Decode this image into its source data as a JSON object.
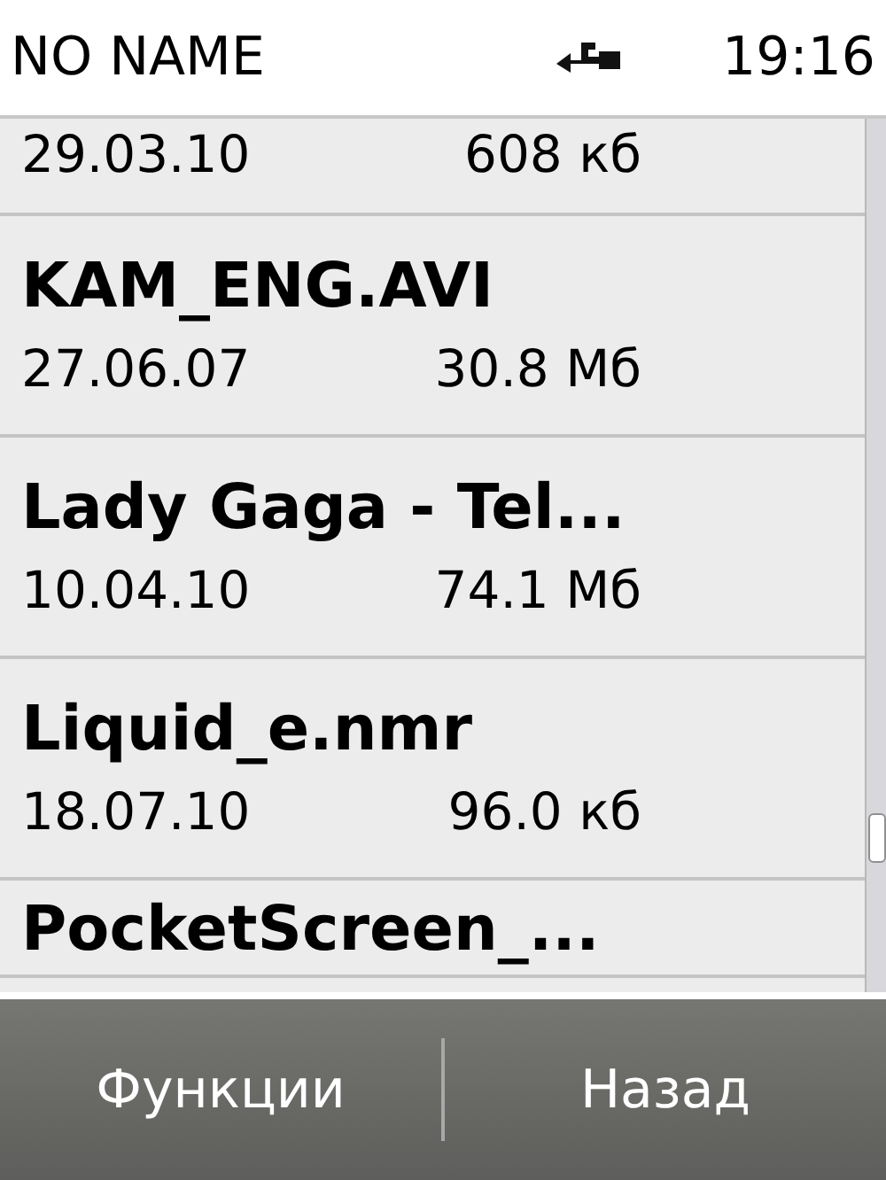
{
  "status_bar": {
    "title": "NO NAME",
    "time": "19:16"
  },
  "files": [
    {
      "date": "29.03.10",
      "size": "608 кб"
    },
    {
      "name": "KAM_ENG.AVI",
      "date": "27.06.07",
      "size": "30.8 Мб"
    },
    {
      "name": "Lady Gaga - Tel...",
      "date": "10.04.10",
      "size": "74.1 Мб"
    },
    {
      "name": "Liquid_e.nmr",
      "date": "18.07.10",
      "size": "96.0 кб"
    },
    {
      "name": "PocketScreen_..."
    }
  ],
  "softkeys": [
    "Функции",
    "Назад"
  ]
}
